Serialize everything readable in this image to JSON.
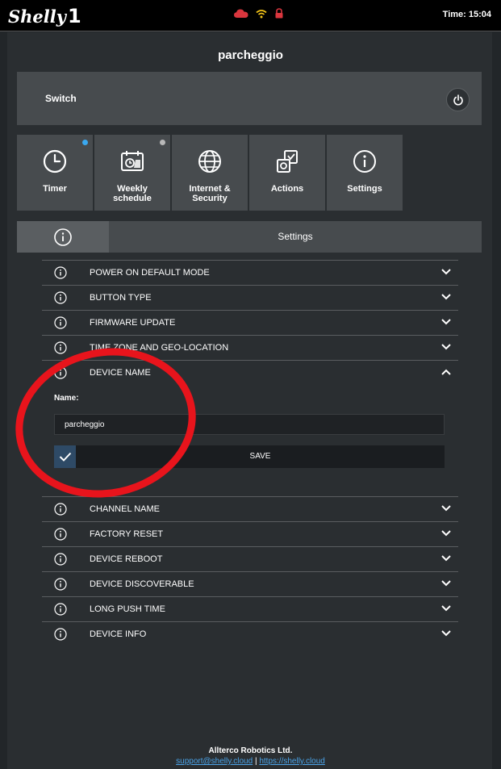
{
  "header": {
    "logo_text": "Shelly",
    "logo_suffix": "1",
    "time_label": "Time: 15:04",
    "status_icons": [
      "cloud-icon",
      "wifi-icon",
      "lock-icon"
    ],
    "status_colors": {
      "cloud": "#d9363e",
      "wifi": "#f5c518",
      "lock": "#d9363e"
    }
  },
  "device": {
    "title": "parcheggio"
  },
  "switch_card": {
    "label": "Switch"
  },
  "tiles": [
    {
      "label": "Timer",
      "icon": "clock-icon",
      "dot_color": "#3aa8f0"
    },
    {
      "label": "Weekly schedule",
      "icon": "calendar-icon",
      "dot_color": "#b8b8b8"
    },
    {
      "label": "Internet & Security",
      "icon": "globe-icon"
    },
    {
      "label": "Actions",
      "icon": "actions-icon"
    },
    {
      "label": "Settings",
      "icon": "info-icon"
    }
  ],
  "tabbar": {
    "settings_label": "Settings"
  },
  "settings": {
    "rows_before": [
      {
        "label": "POWER ON DEFAULT MODE"
      },
      {
        "label": "BUTTON TYPE"
      },
      {
        "label": "FIRMWARE UPDATE"
      },
      {
        "label": "TIME ZONE AND GEO-LOCATION"
      }
    ],
    "expanded": {
      "label": "DEVICE NAME",
      "field_label": "Name:",
      "field_value": "parcheggio",
      "save_label": "SAVE"
    },
    "rows_after": [
      {
        "label": "CHANNEL NAME"
      },
      {
        "label": "FACTORY RESET"
      },
      {
        "label": "DEVICE REBOOT"
      },
      {
        "label": "DEVICE DISCOVERABLE"
      },
      {
        "label": "LONG PUSH TIME"
      },
      {
        "label": "DEVICE INFO"
      }
    ]
  },
  "footer": {
    "company": "Allterco Robotics Ltd.",
    "support_link": "support@shelly.cloud",
    "separator": "|",
    "website_link": "https://shelly.cloud"
  },
  "colors": {
    "accent": "#4aa3e8",
    "annotation_circle": "#e8141c"
  }
}
